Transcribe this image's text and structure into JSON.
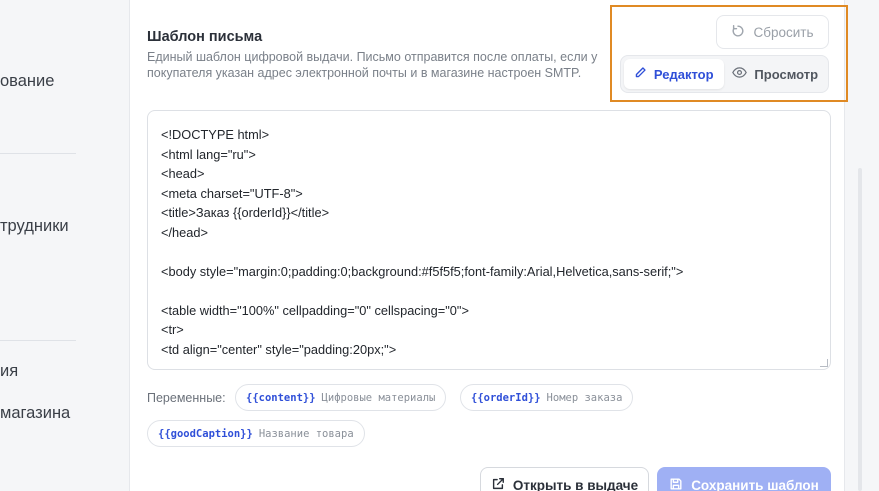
{
  "sidebar": {
    "items": [
      {
        "label": "ование"
      },
      {
        "label": "трудники"
      },
      {
        "label": "ия"
      },
      {
        "label": "магазина"
      }
    ]
  },
  "template": {
    "title": "Шаблон письма",
    "description": "Единый шаблон цифровой выдачи. Письмо отправится после оплаты, если у покупателя указан адрес электронной почты и в магазине настроен SMTP."
  },
  "toolbar": {
    "reset_label": "Сбросить",
    "editor_label": "Редактор",
    "preview_label": "Просмотр",
    "active_mode": "editor"
  },
  "editor": {
    "lines": [
      "<!DOCTYPE html>",
      "<html lang=\"ru\">",
      "<head>",
      "<meta charset=\"UTF-8\">",
      "<title>Заказ {{orderId}}</title>",
      "</head>",
      "",
      "<body style=\"margin:0;padding:0;background:#f5f5f5;font-family:Arial,Helvetica,sans-serif;\">",
      "",
      "<table width=\"100%\" cellpadding=\"0\" cellspacing=\"0\">",
      "<tr>",
      "<td align=\"center\" style=\"padding:20px;\">"
    ]
  },
  "variables": {
    "label": "Переменные:",
    "items": [
      {
        "token": "{{content}}",
        "hint": "Цифровые материалы"
      },
      {
        "token": "{{orderId}}",
        "hint": "Номер заказа"
      },
      {
        "token": "{{goodCaption}}",
        "hint": "Название товара"
      }
    ]
  },
  "actions": {
    "open_label": "Открыть в выдаче",
    "save_label": "Сохранить шаблон"
  },
  "colors": {
    "accent": "#2f4fd8",
    "highlight_border": "#e08a24",
    "save_button": "#9fb0f4"
  }
}
